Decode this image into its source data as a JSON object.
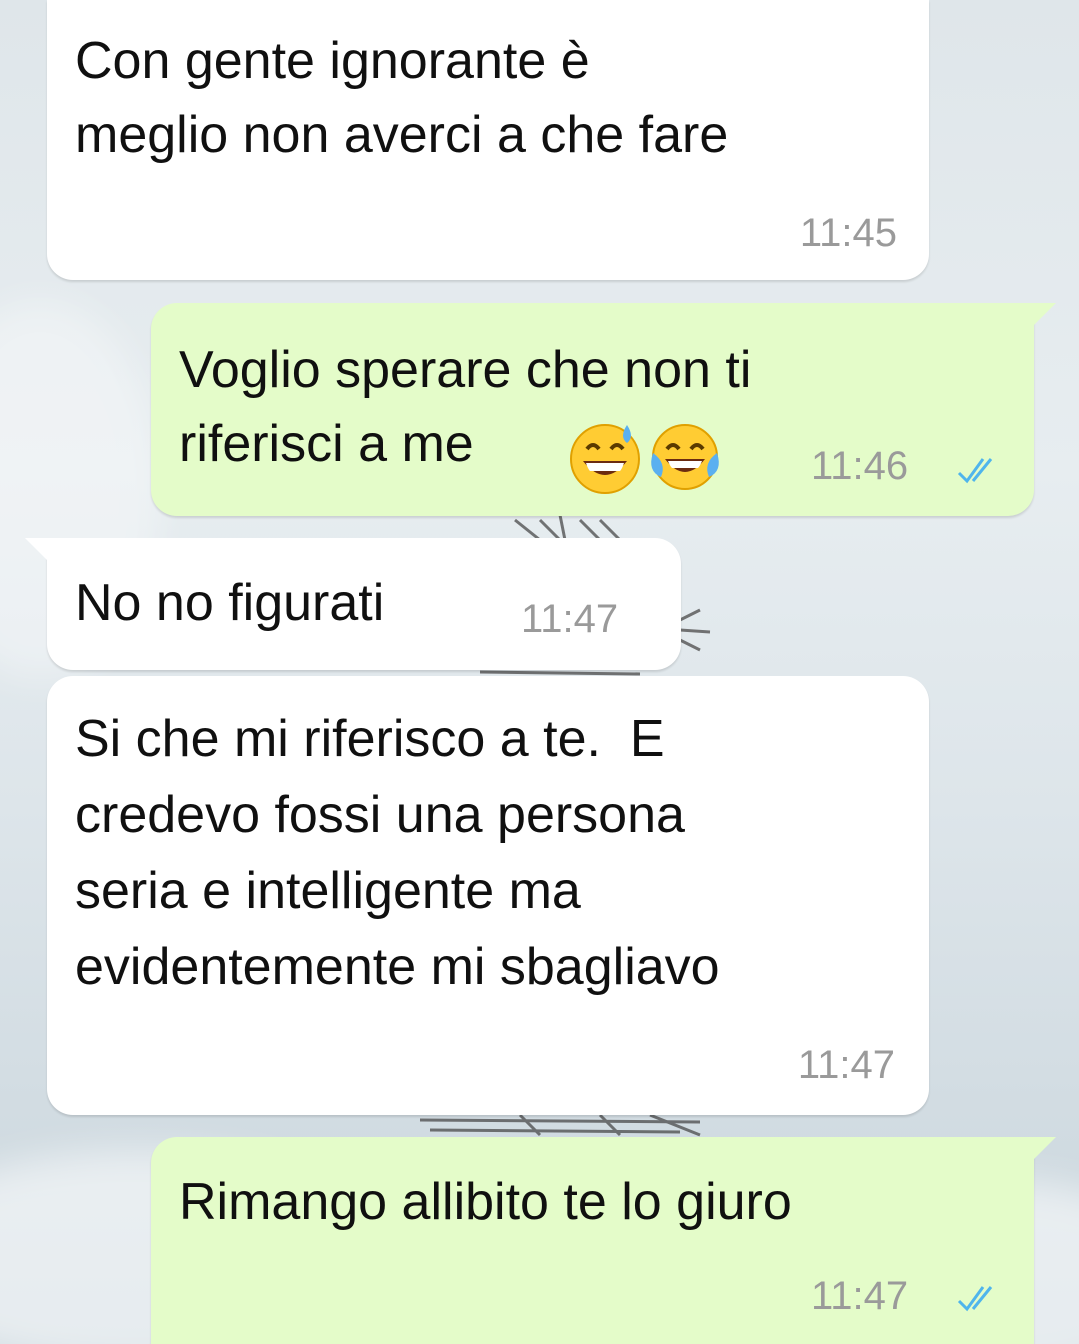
{
  "messages": [
    {
      "direction": "incoming",
      "lines": [
        "Con gente ignorante è",
        "meglio non averci a che fare"
      ],
      "time": "11:45"
    },
    {
      "direction": "outgoing",
      "lines": [
        "Voglio sperare che non ti",
        "riferisci a me"
      ],
      "emoji": [
        "grinning-face-with-sweat-icon",
        "face-with-tears-of-joy-icon"
      ],
      "time": "11:46",
      "status": "read"
    },
    {
      "direction": "incoming",
      "lines": [
        "No no figurati"
      ],
      "time": "11:47"
    },
    {
      "direction": "incoming",
      "lines": [
        "Si che mi riferisco a te.  E",
        "credevo fossi una persona",
        "seria e intelligente ma",
        "evidentemente mi sbagliavo"
      ],
      "time": "11:47"
    },
    {
      "direction": "outgoing",
      "lines": [
        "Rimango allibito te lo giuro"
      ],
      "time": "11:47",
      "status": "read"
    }
  ],
  "colors": {
    "incoming_bubble": "#ffffff",
    "outgoing_bubble": "#e4fcc9",
    "timestamp": "#9a9a9a",
    "read_ticks": "#4fb5ec"
  }
}
